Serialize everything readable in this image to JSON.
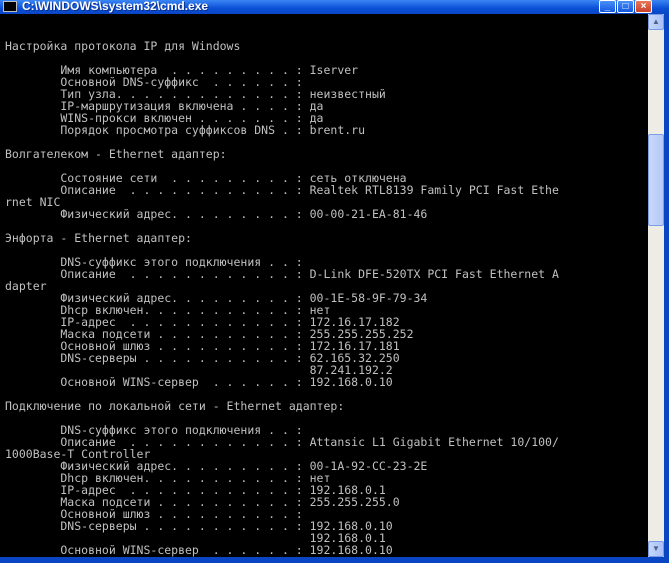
{
  "window": {
    "title": "C:\\WINDOWS\\system32\\cmd.exe",
    "minimize_glyph": "_",
    "maximize_glyph": "□",
    "close_glyph": "×"
  },
  "scrollbar": {
    "up_glyph": "▲",
    "down_glyph": "▼"
  },
  "console": {
    "lines": [
      "",
      "Настройка протокола IP для Windows",
      "",
      "        Имя компьютера  . . . . . . . . . : Iserver",
      "        Основной DNS-суффикс  . . . . . . :",
      "        Тип узла. . . . . . . . . . . . . : неизвестный",
      "        IP-маршрутизация включена . . . . : да",
      "        WINS-прокси включен . . . . . . . : да",
      "        Порядок просмотра суффиксов DNS . : brent.ru",
      "",
      "Волгателеком - Ethernet адаптер:",
      "",
      "        Состояние сети  . . . . . . . . . : сеть отключена",
      "        Описание  . . . . . . . . . . . . : Realtek RTL8139 Family PCI Fast Ethe",
      "rnet NIC",
      "        Физический адрес. . . . . . . . . : 00-00-21-EA-81-46",
      "",
      "Энфорта - Ethernet адаптер:",
      "",
      "        DNS-суффикс этого подключения . . :",
      "        Описание  . . . . . . . . . . . . : D-Link DFE-520TX PCI Fast Ethernet A",
      "dapter",
      "        Физический адрес. . . . . . . . . : 00-1E-58-9F-79-34",
      "        Dhcp включен. . . . . . . . . . . : нет",
      "        IP-адрес  . . . . . . . . . . . . : 172.16.17.182",
      "        Маска подсети . . . . . . . . . . : 255.255.255.252",
      "        Основной шлюз . . . . . . . . . . : 172.16.17.181",
      "        DNS-серверы . . . . . . . . . . . : 62.165.32.250",
      "                                            87.241.192.2",
      "        Основной WINS-сервер  . . . . . . : 192.168.0.10",
      "",
      "Подключение по локальной сети - Ethernet адаптер:",
      "",
      "        DNS-суффикс этого подключения . . :",
      "        Описание  . . . . . . . . . . . . : Attansic L1 Gigabit Ethernet 10/100/",
      "1000Base-T Controller",
      "        Физический адрес. . . . . . . . . : 00-1A-92-CC-23-2E",
      "        Dhcp включен. . . . . . . . . . . : нет",
      "        IP-адрес  . . . . . . . . . . . . : 192.168.0.1",
      "        Маска подсети . . . . . . . . . . : 255.255.255.0",
      "        Основной шлюз . . . . . . . . . . :",
      "        DNS-серверы . . . . . . . . . . . : 192.168.0.10",
      "                                            192.168.0.1",
      "        Основной WINS-сервер  . . . . . . : 192.168.0.10"
    ]
  }
}
